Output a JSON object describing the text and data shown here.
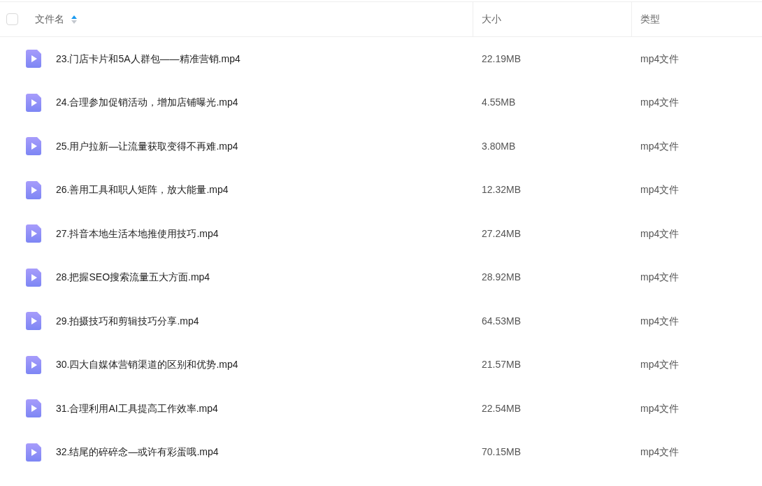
{
  "table": {
    "select_all": {
      "checked": false
    },
    "columns": [
      {
        "label": "文件名",
        "sorted": true
      },
      {
        "label": "大小",
        "sorted": false
      },
      {
        "label": "类型",
        "sorted": false
      }
    ],
    "rows": [
      {
        "name": "23.门店卡片和5A人群包——精准营销.mp4",
        "size": "22.19MB",
        "type": "mp4文件"
      },
      {
        "name": "24.合理参加促销活动，增加店铺曝光.mp4",
        "size": "4.55MB",
        "type": "mp4文件"
      },
      {
        "name": "25.用户拉新—让流量获取变得不再难.mp4",
        "size": "3.80MB",
        "type": "mp4文件"
      },
      {
        "name": "26.善用工具和职人矩阵，放大能量.mp4",
        "size": "12.32MB",
        "type": "mp4文件"
      },
      {
        "name": "27.抖音本地生活本地推使用技巧.mp4",
        "size": "27.24MB",
        "type": "mp4文件"
      },
      {
        "name": "28.把握SEO搜索流量五大方面.mp4",
        "size": "28.92MB",
        "type": "mp4文件"
      },
      {
        "name": "29.拍摄技巧和剪辑技巧分享.mp4",
        "size": "64.53MB",
        "type": "mp4文件"
      },
      {
        "name": "30.四大自媒体营销渠道的区别和优势.mp4",
        "size": "21.57MB",
        "type": "mp4文件"
      },
      {
        "name": "31.合理利用AI工具提高工作效率.mp4",
        "size": "22.54MB",
        "type": "mp4文件"
      },
      {
        "name": "32.结尾的碎碎念—或许有彩蛋哦.mp4",
        "size": "70.15MB",
        "type": "mp4文件"
      }
    ]
  }
}
